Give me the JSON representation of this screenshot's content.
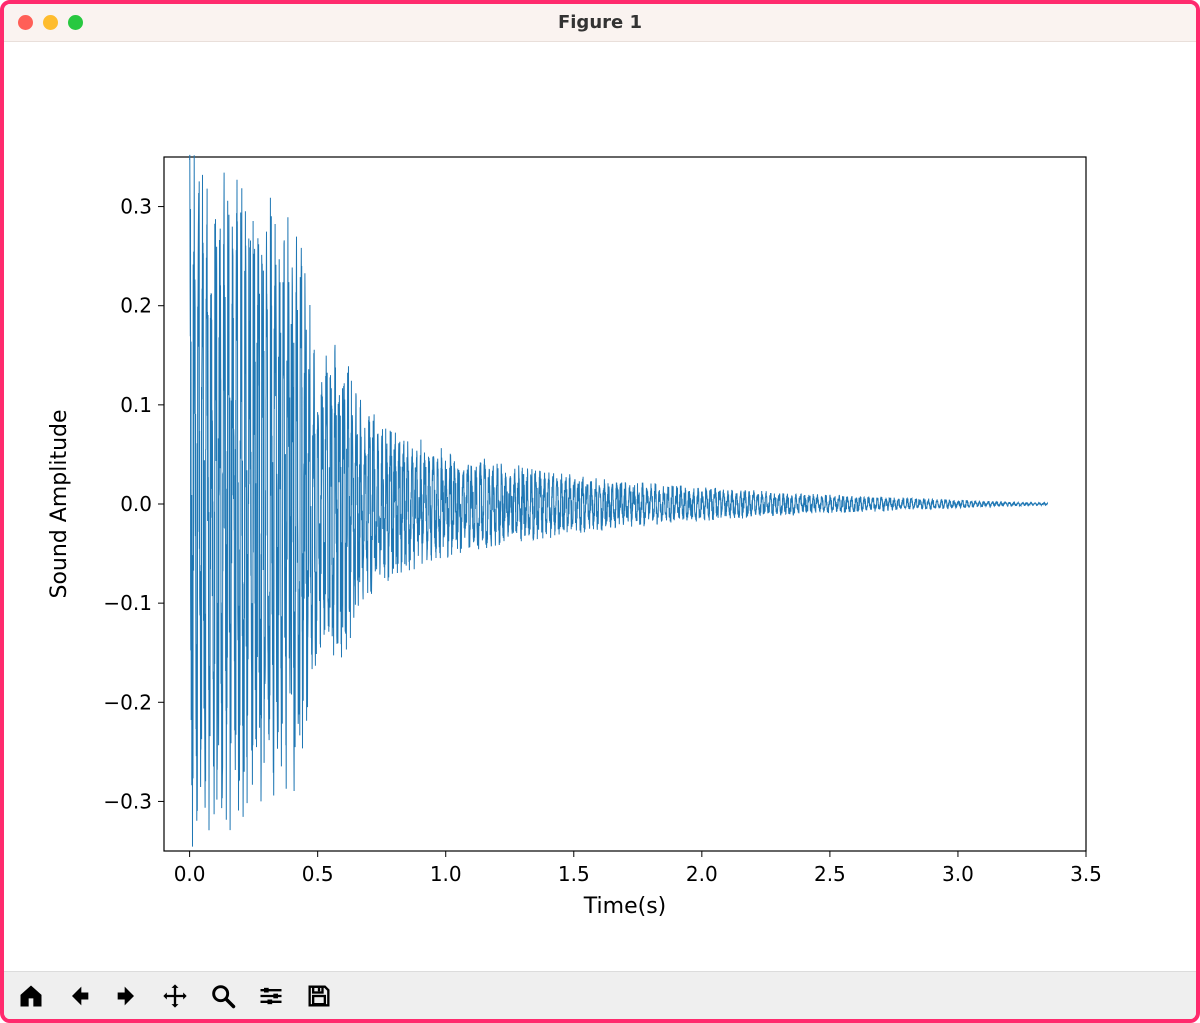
{
  "window": {
    "title": "Figure 1"
  },
  "toolbar": {
    "buttons": [
      {
        "name": "home-button",
        "icon": "home-icon"
      },
      {
        "name": "back-button",
        "icon": "arrow-left-icon"
      },
      {
        "name": "forward-button",
        "icon": "arrow-right-icon"
      },
      {
        "name": "pan-button",
        "icon": "move-icon"
      },
      {
        "name": "zoom-button",
        "icon": "magnify-icon"
      },
      {
        "name": "configure-button",
        "icon": "sliders-icon"
      },
      {
        "name": "save-button",
        "icon": "save-icon"
      }
    ]
  },
  "chart_data": {
    "type": "line",
    "title": "",
    "xlabel": "Time(s)",
    "ylabel": "Sound Amplitude",
    "xlim": [
      -0.1,
      3.5
    ],
    "ylim": [
      -0.35,
      0.35
    ],
    "xticks": [
      0.0,
      0.5,
      1.0,
      1.5,
      2.0,
      2.5,
      3.0,
      3.5
    ],
    "xtick_labels": [
      "0.0",
      "0.5",
      "1.0",
      "1.5",
      "2.0",
      "2.5",
      "3.0",
      "3.5"
    ],
    "yticks": [
      -0.3,
      -0.2,
      -0.1,
      0.0,
      0.1,
      0.2,
      0.3
    ],
    "ytick_labels": [
      "−0.3",
      "−0.2",
      "−0.1",
      "0.0",
      "0.1",
      "0.2",
      "0.3"
    ],
    "line_color": "#1f77b4",
    "grid": false,
    "description": "Decaying audio waveform. Envelope values below approximate the upper amplitude envelope; waveform is roughly symmetric about 0.",
    "x_range_data": [
      0.0,
      3.35
    ],
    "envelope": [
      {
        "t": 0.0,
        "amp": 0.335
      },
      {
        "t": 0.05,
        "amp": 0.335
      },
      {
        "t": 0.1,
        "amp": 0.32
      },
      {
        "t": 0.15,
        "amp": 0.3
      },
      {
        "t": 0.2,
        "amp": 0.32
      },
      {
        "t": 0.25,
        "amp": 0.28
      },
      {
        "t": 0.3,
        "amp": 0.31
      },
      {
        "t": 0.35,
        "amp": 0.26
      },
      {
        "t": 0.4,
        "amp": 0.28
      },
      {
        "t": 0.45,
        "amp": 0.24
      },
      {
        "t": 0.5,
        "amp": 0.13
      },
      {
        "t": 0.55,
        "amp": 0.15
      },
      {
        "t": 0.6,
        "amp": 0.16
      },
      {
        "t": 0.65,
        "amp": 0.11
      },
      {
        "t": 0.7,
        "amp": 0.09
      },
      {
        "t": 0.8,
        "amp": 0.07
      },
      {
        "t": 0.9,
        "amp": 0.06
      },
      {
        "t": 1.0,
        "amp": 0.05
      },
      {
        "t": 1.2,
        "amp": 0.04
      },
      {
        "t": 1.4,
        "amp": 0.032
      },
      {
        "t": 1.6,
        "amp": 0.025
      },
      {
        "t": 1.8,
        "amp": 0.02
      },
      {
        "t": 2.0,
        "amp": 0.016
      },
      {
        "t": 2.2,
        "amp": 0.013
      },
      {
        "t": 2.4,
        "amp": 0.01
      },
      {
        "t": 2.6,
        "amp": 0.008
      },
      {
        "t": 2.8,
        "amp": 0.006
      },
      {
        "t": 3.0,
        "amp": 0.004
      },
      {
        "t": 3.2,
        "amp": 0.002
      },
      {
        "t": 3.35,
        "amp": 0.001
      }
    ]
  }
}
